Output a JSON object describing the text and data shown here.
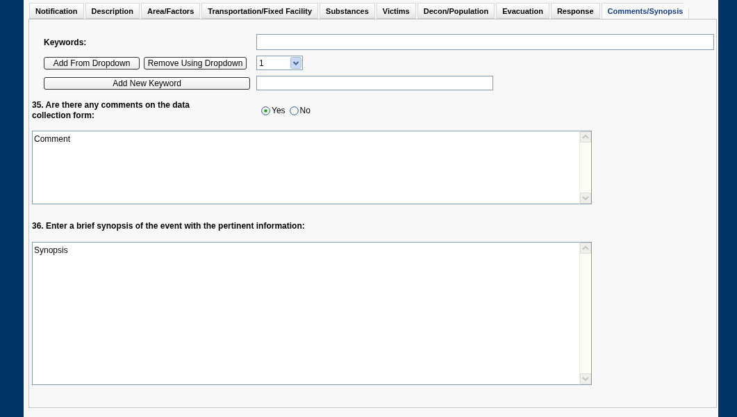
{
  "tabs": [
    {
      "label": "Notification",
      "selected": false
    },
    {
      "label": "Description",
      "selected": false
    },
    {
      "label": "Area/Factors",
      "selected": false
    },
    {
      "label": "Transportation/Fixed Facility",
      "selected": false
    },
    {
      "label": "Substances",
      "selected": false
    },
    {
      "label": "Victims",
      "selected": false
    },
    {
      "label": "Decon/Population",
      "selected": false
    },
    {
      "label": "Evacuation",
      "selected": false
    },
    {
      "label": "Response",
      "selected": false
    },
    {
      "label": "Comments/Synopsis",
      "selected": true
    }
  ],
  "keywords": {
    "label": "Keywords:",
    "buttons": [
      "Add From Dropdown",
      "Remove Using Dropdown"
    ],
    "dropdown": {
      "value": "1"
    },
    "add_button": "Add New Keyword"
  },
  "question_35": {
    "label": "35. Are there any comments on the data collection form:",
    "options": [
      {
        "label": "Yes",
        "selected": true
      },
      {
        "label": "No",
        "selected": false
      }
    ],
    "comment": {
      "value": "Comment"
    }
  },
  "question_36": {
    "label": "36. Enter a brief synopsis of the event with the pertinent information:",
    "synopsis": {
      "value": "Synopsis"
    }
  }
}
